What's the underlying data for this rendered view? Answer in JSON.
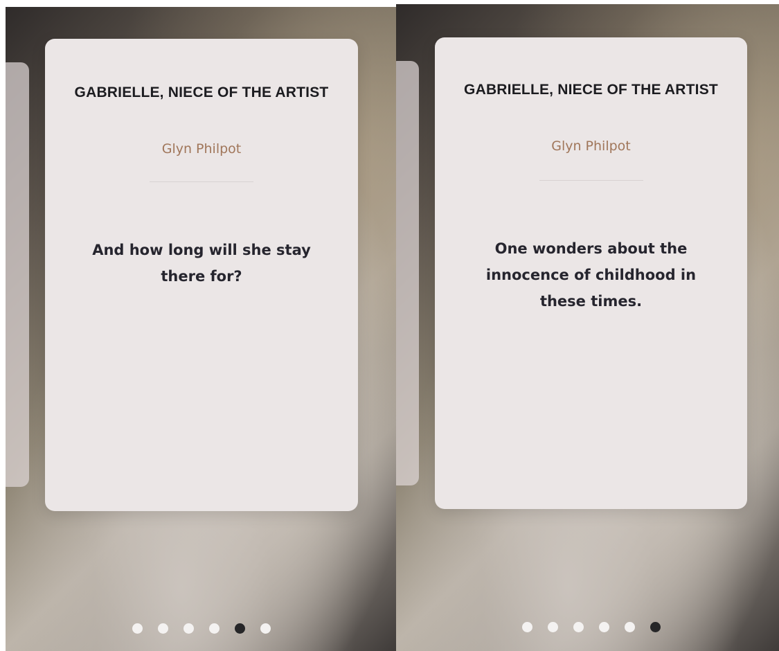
{
  "screens": [
    {
      "card": {
        "title": "GABRIELLE, NIECE OF THE ARTIST",
        "artist": "Glyn Philpot",
        "quote": "And how long will she stay there for?"
      },
      "pagination": {
        "total": 6,
        "active_index": 4
      }
    },
    {
      "card": {
        "title": "GABRIELLE, NIECE OF THE ARTIST",
        "artist": "Glyn Philpot",
        "quote": "One wonders about the innocence of childhood in these times."
      },
      "pagination": {
        "total": 6,
        "active_index": 5
      }
    }
  ],
  "colors": {
    "card_background": "#ebe6e6",
    "artist_accent": "#a0765a",
    "dot_inactive": "#f4f2f1",
    "dot_active": "#262628"
  }
}
